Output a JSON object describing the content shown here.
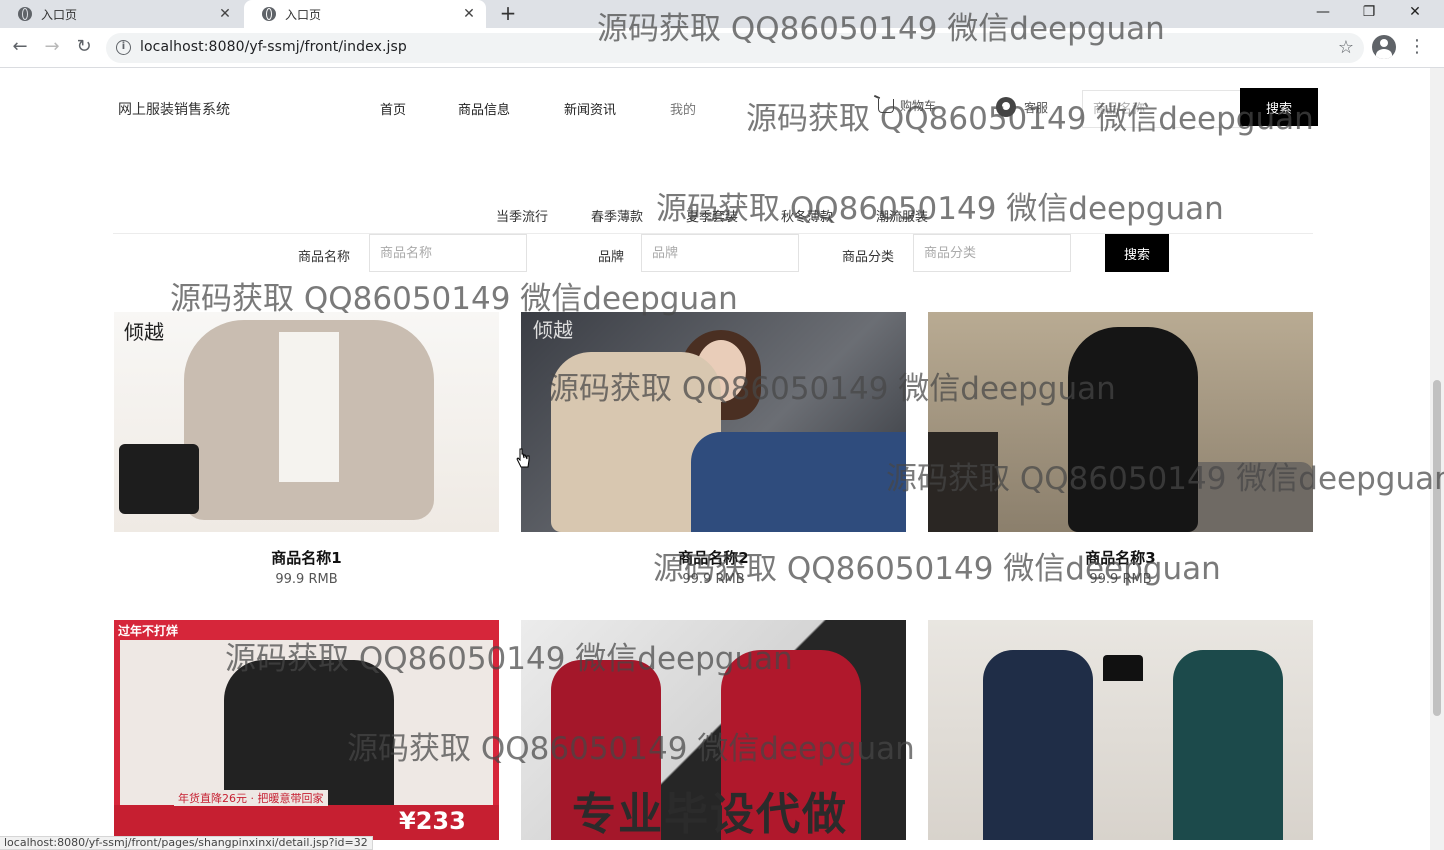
{
  "browser": {
    "tabs": [
      {
        "title": "入口页",
        "active": false
      },
      {
        "title": "入口页",
        "active": true
      }
    ],
    "new_tab": "+",
    "url": "localhost:8080/yf-ssmj/front/index.jsp",
    "status_url": "localhost:8080/yf-ssmj/front/pages/shangpinxinxi/detail.jsp?id=32"
  },
  "header": {
    "site_title": "网上服装销售系统",
    "nav": [
      "首页",
      "商品信息",
      "新闻资讯",
      "我的",
      "购物车",
      "客服"
    ],
    "search_placeholder": "商品名称",
    "search_button": "搜索"
  },
  "categories": [
    "当季流行",
    "春季薄款",
    "夏季套装",
    "秋冬薄款",
    "潮流服装"
  ],
  "filter": {
    "name_label": "商品名称",
    "name_placeholder": "商品名称",
    "brand_label": "品牌",
    "brand_placeholder": "品牌",
    "category_label": "商品分类",
    "category_placeholder": "商品分类",
    "button": "搜索"
  },
  "products": [
    {
      "name": "商品名称1",
      "price": "99.9 RMB",
      "image_text": "倾越"
    },
    {
      "name": "商品名称2",
      "price": "99.9 RMB",
      "image_text": "倾越"
    },
    {
      "name": "商品名称3",
      "price": "99.9 RMB"
    },
    {
      "image_text": "过年不打烊",
      "image_caption": "年货直降26元 · 把暖意带回家",
      "image_price": "¥233"
    },
    {
      "image_overlay": "专业毕设代做"
    },
    {}
  ],
  "watermark": "源码获取 QQ86050149 微信deepguan",
  "colors": {
    "accent": "#000000",
    "tab_bar": "#dee1e6",
    "omnibox": "#f1f3f4"
  }
}
